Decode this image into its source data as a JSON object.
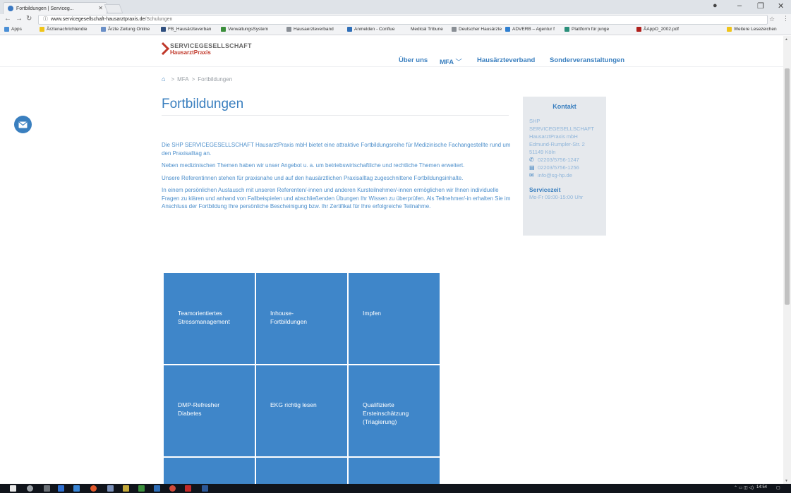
{
  "browser": {
    "tab_title": "Fortbildungen | Serviceg...",
    "url_host": "www.servicegesellschaft-hausarztpraxis.de",
    "url_path": "/Schulungen",
    "bookmarks": [
      "Apps",
      "Ärztenachrichtendie",
      "Ärzte Zeitung Online",
      "FB_Hausärzteverban",
      "VerwaltungsSystem",
      "Hausaerzteverband",
      "Anmelden - Conflue",
      "Medical Tribune",
      "Deutscher Hausärzte",
      "ADVERB – Agentur f",
      "Plattform für junge",
      "ÄAppO_2002.pdf",
      "Weitere Lesezeichen"
    ]
  },
  "logo": {
    "line1": "SERVICEGESELLSCHAFT",
    "line2": "HausarztPraxis"
  },
  "nav": {
    "items": [
      "Über uns",
      "MFA",
      "Hausärzteverband",
      "Sonderveranstaltungen"
    ]
  },
  "breadcrumb": {
    "sep": ">",
    "items": [
      "MFA",
      "Fortbildungen"
    ]
  },
  "page": {
    "title": "Fortbildungen",
    "paragraphs": [
      "Die SHP SERVICEGESELLSCHAFT HausarztPraxis mbH bietet eine attraktive Fortbildungsreihe für Medizinische Fachangestellte rund um den Praxisalltag an.",
      "Neben medizinischen Themen haben wir unser Angebot u. a. um betriebswirtschaftliche und rechtliche Themen erweitert.",
      "Unsere Referentinnen stehen für praxisnahe und auf den hausärztlichen Praxisalltag zugeschnittene Fortbildungsinhalte.",
      "In einem persönlichen Austausch mit unseren Referenten/-innen und anderen Kursteilnehmer/-innen ermöglichen wir Ihnen individuelle Fragen zu klären und anhand von Fallbeispielen und abschließenden Übungen Ihr Wissen zu überprüfen. Als Teilnehmer/-in erhalten Sie im Anschluss der Fortbildung Ihre persönliche Bescheinigung bzw. Ihr Zertifikat für Ihre erfolgreiche Teilnahme."
    ]
  },
  "contact": {
    "title": "Kontakt",
    "lines": [
      "SHP",
      "SERVICEGESELLSCHAFT",
      "HausarztPraxis mbH",
      "Edmund-Rumpler-Str. 2",
      "51149 Köln"
    ],
    "phone": "02203/5756-1247",
    "fax": "02203/5756-1256",
    "email": "info@sg-hp.de",
    "service_title": "Servicezeit",
    "service_hours": "Mo-Fr 09:00-15:00 Uhr"
  },
  "courses": [
    {
      "line1": "Teamorientiertes",
      "line2": "Stressmanagement",
      "line3": ""
    },
    {
      "line1": "Inhouse-",
      "line2": "Fortbildungen",
      "line3": ""
    },
    {
      "line1": "Impfen",
      "line2": "",
      "line3": ""
    },
    {
      "line1": "DMP-Refresher",
      "line2": "Diabetes",
      "line3": ""
    },
    {
      "line1": "EKG richtig lesen",
      "line2": "",
      "line3": ""
    },
    {
      "line1": "Qualifizierte",
      "line2": "Ersteinschätzung",
      "line3": "(Triagierung)"
    }
  ],
  "taskbar": {
    "time": "14:54"
  },
  "colors": {
    "accent": "#3a7fbf",
    "tile": "#3f86c9",
    "logo_red": "#c0392b"
  }
}
